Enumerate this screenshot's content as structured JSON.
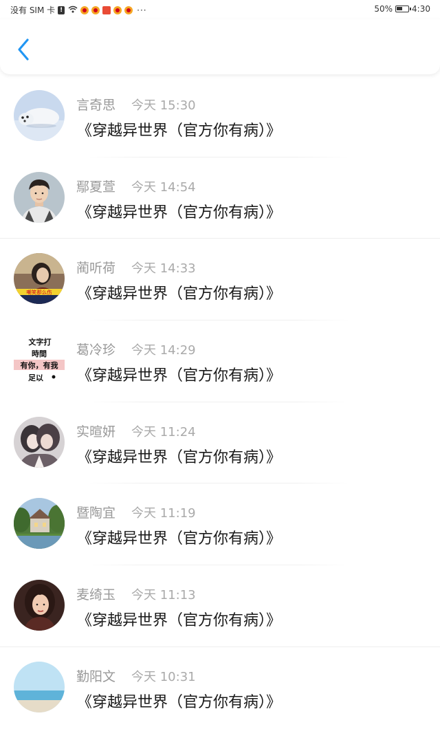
{
  "status_bar": {
    "carrier": "没有 SIM 卡",
    "sim_alert": "!",
    "more": "···",
    "battery": "50%",
    "time": "4:30"
  },
  "header": {
    "back_icon": "chevron-left-icon",
    "accent_color": "#2196f3"
  },
  "messages": [
    {
      "name": "言奇思",
      "time": "今天 15:30",
      "text": "《穿越异世界（官方你有病）》"
    },
    {
      "name": "鄢夏萱",
      "time": "今天 14:54",
      "text": "《穿越异世界（官方你有病）》"
    },
    {
      "name": "蔺听荷",
      "time": "今天 14:33",
      "text": "《穿越异世界（官方你有病）》"
    },
    {
      "name": "葛冷珍",
      "time": "今天 14:29",
      "text": "《穿越异世界（官方你有病）》"
    },
    {
      "name": "实暄妍",
      "time": "今天 11:24",
      "text": "《穿越异世界（官方你有病）》"
    },
    {
      "name": "暨陶宜",
      "time": "今天 11:19",
      "text": "《穿越异世界（官方你有病）》"
    },
    {
      "name": "麦绮玉",
      "time": "今天 11:13",
      "text": "《穿越异世界（官方你有病）》"
    },
    {
      "name": "勤阳文",
      "time": "今天 10:31",
      "text": "《穿越异世界（官方你有病）》"
    }
  ],
  "avatar_text": {
    "a3_banner": "嘲笑那么伤",
    "a4_lines": [
      "文字打",
      "時間",
      "有你，有我",
      "足以"
    ]
  }
}
